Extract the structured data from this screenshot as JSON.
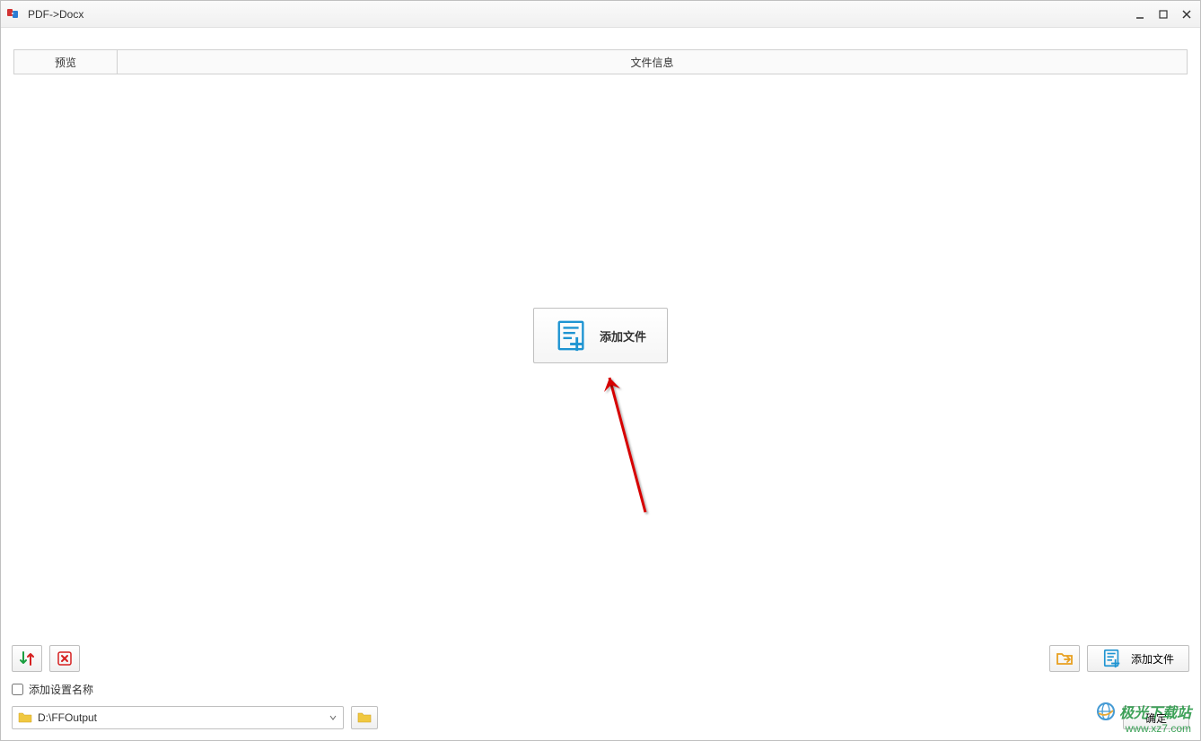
{
  "window": {
    "title": "PDF->Docx"
  },
  "tabs": {
    "preview": "预览",
    "fileinfo": "文件信息"
  },
  "center_button": {
    "label": "添加文件"
  },
  "bottom": {
    "add_file_label": "添加文件",
    "checkbox_label": "添加设置名称",
    "output_path": "D:\\FFOutput",
    "confirm_label": "确定"
  },
  "watermark": {
    "line1": "极光下载站",
    "line2": "www.xz7.com"
  }
}
